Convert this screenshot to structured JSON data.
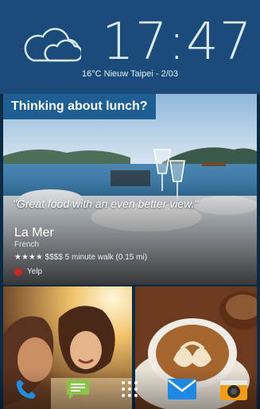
{
  "clock": {
    "time": "17:47"
  },
  "weather": {
    "summary": "16°C Nieuw Taipei - 2/03",
    "icon": "cloud-icon"
  },
  "suggestion": {
    "heading": "Thinking about lunch?",
    "quote": "\"Great food with an even better view.\"",
    "place_name": "La Mer",
    "category": "French",
    "rating_price_distance": "★★★★ $$$$ 5 minute walk (0.15 mi)",
    "source": "Yelp"
  },
  "dock": [
    {
      "name": "phone",
      "icon": "phone-icon"
    },
    {
      "name": "messages",
      "icon": "message-icon"
    },
    {
      "name": "apps",
      "icon": "app-grid-icon"
    },
    {
      "name": "mail",
      "icon": "mail-icon"
    },
    {
      "name": "camera",
      "icon": "camera-icon"
    }
  ],
  "colors": {
    "widget_bg": "#1b4c79",
    "heading_band": "#1f5e92",
    "phone": "#1e8fe0",
    "messages": "#8bc34a",
    "mail": "#1e88e5",
    "camera": "#f39c12"
  }
}
